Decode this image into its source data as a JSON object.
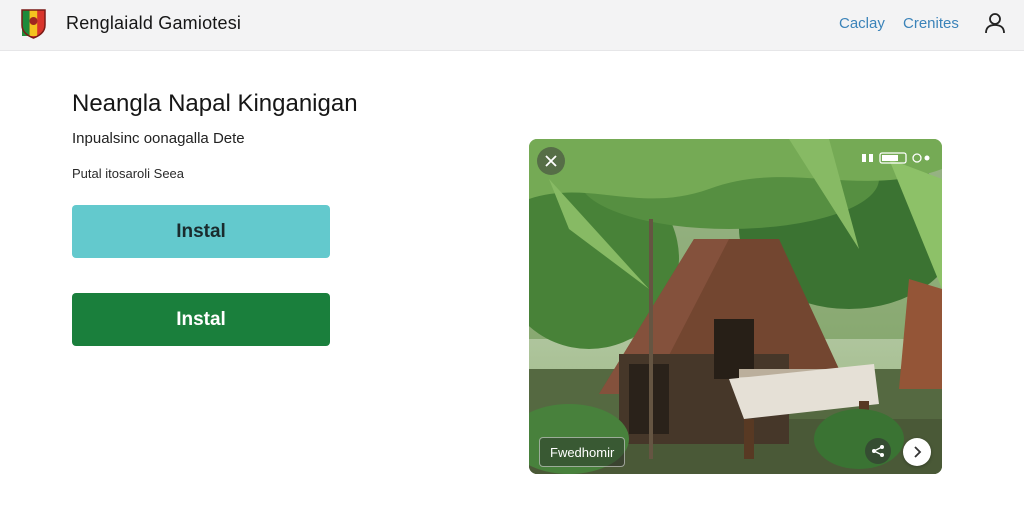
{
  "header": {
    "app_title": "Renglaiald Gamiotesi",
    "nav": [
      {
        "label": "Caclay"
      },
      {
        "label": "Crenites"
      }
    ],
    "logo_icon": "shield-flag-icon",
    "user_icon": "user-icon"
  },
  "main": {
    "title": "Neangla Napal Kinganigan",
    "subtitle": "Ιnpualsinc oonagalla Dete",
    "small_text": "Ρutal itosaroli Seea",
    "buttons": [
      {
        "label": "Instal",
        "color": "#63c9cd"
      },
      {
        "label": "Instal",
        "color": "#1a7f3c"
      }
    ]
  },
  "media": {
    "caption": "Fwedhomir",
    "close_icon": "close-icon",
    "share_icon": "share-icon",
    "next_icon": "chevron-right-icon"
  }
}
